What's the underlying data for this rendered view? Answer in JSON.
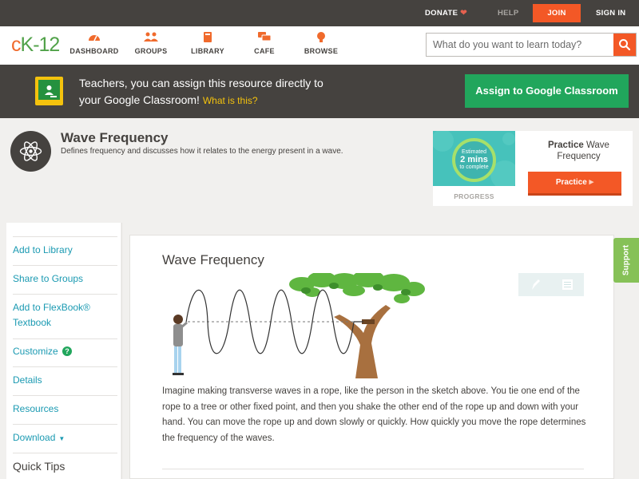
{
  "topbar": {
    "donate": "DONATE",
    "help": "HELP",
    "join": "JOIN",
    "signin": "SIGN IN"
  },
  "nav": {
    "logo": {
      "c": "c",
      "k": "K",
      "n": "12"
    },
    "items": [
      {
        "label": "DASHBOARD",
        "icon": "dashboard-gauge-icon"
      },
      {
        "label": "GROUPS",
        "icon": "groups-people-icon"
      },
      {
        "label": "LIBRARY",
        "icon": "library-book-icon"
      },
      {
        "label": "CAFE",
        "icon": "cafe-chat-icon"
      },
      {
        "label": "BROWSE",
        "icon": "browse-lightbulb-icon"
      }
    ],
    "search_placeholder": "What do you want to learn today?"
  },
  "banner": {
    "line1": "Teachers, you can assign this resource directly to",
    "line2": "your Google Classroom!",
    "what": "What is this?",
    "button": "Assign to Google Classroom"
  },
  "concept": {
    "title": "Wave Frequency",
    "description": "Defines frequency and discusses how it relates to the energy present in a wave."
  },
  "practice": {
    "estimated": "Estimated",
    "mins": "2 mins",
    "to_complete": "to complete",
    "progress_label": "PROGRESS",
    "title_bold": "Practice",
    "title_rest": "Wave Frequency",
    "button": "Practice"
  },
  "sidebar": {
    "items": [
      "Add to Library",
      "Share to Groups",
      "Add to FlexBook® Textbook",
      "Customize",
      "Details",
      "Resources",
      "Download"
    ],
    "quick_tips": "Quick Tips"
  },
  "content": {
    "title": "Wave Frequency",
    "paragraph": "Imagine making transverse waves in a rope, like the person in the sketch above. You tie one end of the rope to a tree or other fixed point, and then you shake the other end of the rope up and down with your hand. You can move the rope up and down slowly or quickly. How quickly you move the rope determines the frequency of the waves."
  },
  "support": "Support",
  "colors": {
    "accent_orange": "#f35826",
    "brand_green": "#21a65c",
    "link_blue": "#1b9ab2",
    "dark_bar": "#45423f"
  }
}
